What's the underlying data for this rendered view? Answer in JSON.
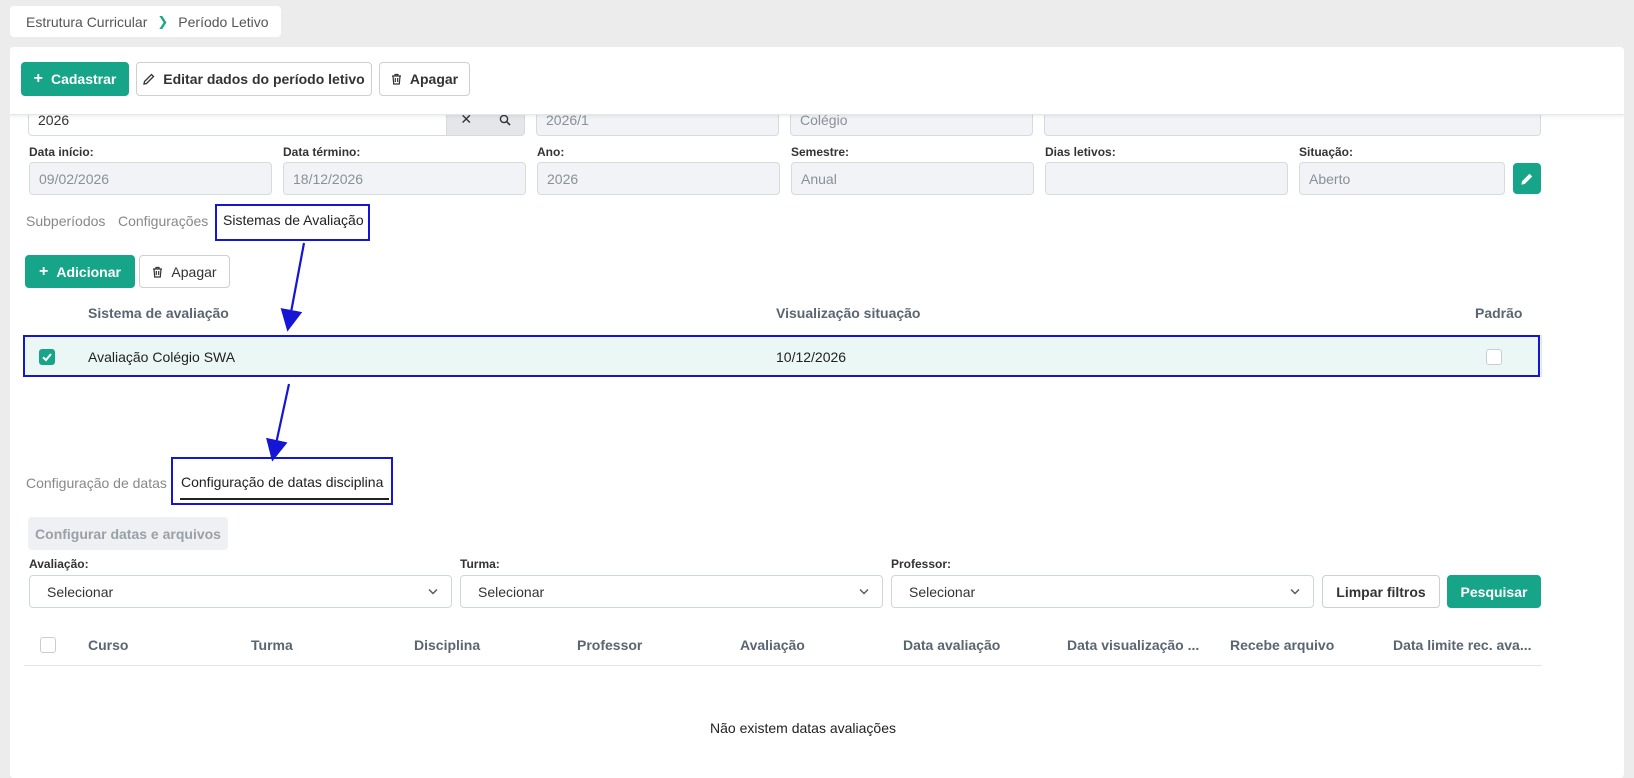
{
  "breadcrumb": {
    "parent": "Estrutura Curricular",
    "current": "Período Letivo"
  },
  "toolbar": {
    "cadastrar": "Cadastrar",
    "editar": "Editar dados do período letivo",
    "apagar": "Apagar"
  },
  "form_top": {
    "search_value": "2026",
    "periodo": "2026/1",
    "unidade": "Colégio",
    "extra": ""
  },
  "form": {
    "data_inicio_label": "Data início:",
    "data_inicio": "09/02/2026",
    "data_termino_label": "Data término:",
    "data_termino": "18/12/2026",
    "ano_label": "Ano:",
    "ano": "2026",
    "semestre_label": "Semestre:",
    "semestre": "Anual",
    "dias_label": "Dias letivos:",
    "dias": "",
    "situacao_label": "Situação:",
    "situacao": "Aberto"
  },
  "tabs": [
    "Subperíodos",
    "Configurações",
    "Sistemas de Avaliação"
  ],
  "sistema": {
    "adicionar": "Adicionar",
    "apagar": "Apagar",
    "col_sistema": "Sistema de avaliação",
    "col_visualizacao": "Visualização situação",
    "col_padrao": "Padrão",
    "row": {
      "sistema": "Avaliação Colégio SWA",
      "visualizacao": "10/12/2026"
    }
  },
  "subtabs": [
    "Configuração de datas",
    "Configuração de datas disciplina"
  ],
  "datas": {
    "configurar": "Configurar datas e arquivos",
    "avaliacao_label": "Avaliação:",
    "turma_label": "Turma:",
    "professor_label": "Professor:",
    "select_placeholder": "Selecionar",
    "limpar": "Limpar filtros",
    "pesquisar": "Pesquisar",
    "columns": [
      "Curso",
      "Turma",
      "Disciplina",
      "Professor",
      "Avaliação",
      "Data avaliação",
      "Data visualização ...",
      "Recebe arquivo",
      "Data limite rec. ava..."
    ],
    "empty": "Não existem datas avaliações"
  },
  "colors": {
    "primary": "#17a589",
    "annotation": "#1515d6"
  }
}
